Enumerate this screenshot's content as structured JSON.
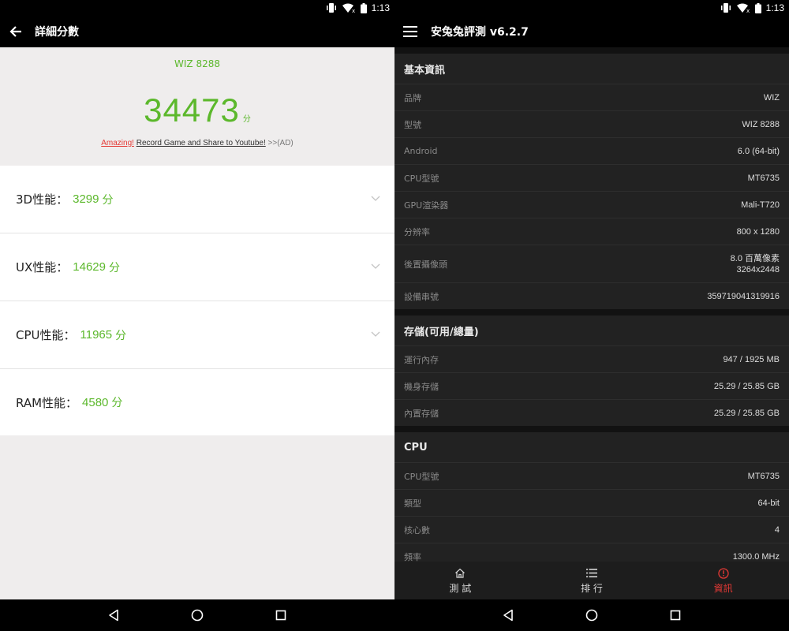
{
  "left": {
    "status_time": "1:13",
    "title": "詳細分數",
    "device_name": "WIZ 8288",
    "total_score": "34473",
    "score_unit": "分",
    "promo": {
      "amazing": "Amazing!",
      "record": "Record Game and Share to Youtube!",
      "ad": ">>(AD)"
    },
    "scores": [
      {
        "label": "3D性能：",
        "value": "3299",
        "unit": "分"
      },
      {
        "label": "UX性能：",
        "value": "14629",
        "unit": "分"
      },
      {
        "label": "CPU性能：",
        "value": "11965",
        "unit": "分"
      },
      {
        "label": "RAM性能：",
        "value": "4580",
        "unit": "分"
      }
    ]
  },
  "right": {
    "status_time": "1:13",
    "title": "安兔兔評測 v6.2.7",
    "sections": [
      {
        "header": "基本資訊",
        "rows": [
          {
            "k": "品牌",
            "v": "WIZ"
          },
          {
            "k": "型號",
            "v": "WIZ 8288"
          },
          {
            "k": "Android",
            "v": "6.0 (64-bit)"
          },
          {
            "k": "CPU型號",
            "v": "MT6735"
          },
          {
            "k": "GPU渲染器",
            "v": "Mali-T720"
          },
          {
            "k": "分辨率",
            "v": "800 x 1280"
          },
          {
            "k": "後置攝像頭",
            "v": "8.0 百萬像素",
            "v2": "3264x2448"
          },
          {
            "k": "設備串號",
            "v": "359719041319916"
          }
        ]
      },
      {
        "header": "存儲(可用/總量)",
        "rows": [
          {
            "k": "運行內存",
            "v": "947 / 1925 MB"
          },
          {
            "k": "機身存儲",
            "v": "25.29 / 25.85 GB"
          },
          {
            "k": "內置存儲",
            "v": "25.29 / 25.85 GB"
          }
        ]
      },
      {
        "header": "CPU",
        "rows": [
          {
            "k": "CPU型號",
            "v": "MT6735"
          },
          {
            "k": "類型",
            "v": "64-bit"
          },
          {
            "k": "核心數",
            "v": "4"
          },
          {
            "k": "頻率",
            "v": "1300.0 MHz"
          }
        ]
      }
    ],
    "tabs": [
      {
        "label": "測 試",
        "icon": "home-icon"
      },
      {
        "label": "排 行",
        "icon": "list-icon"
      },
      {
        "label": "資訊",
        "icon": "info-icon",
        "active": true
      }
    ],
    "accent": "#e53935"
  },
  "colors": {
    "score_green": "#5cb82c",
    "accent_red": "#e53935"
  }
}
